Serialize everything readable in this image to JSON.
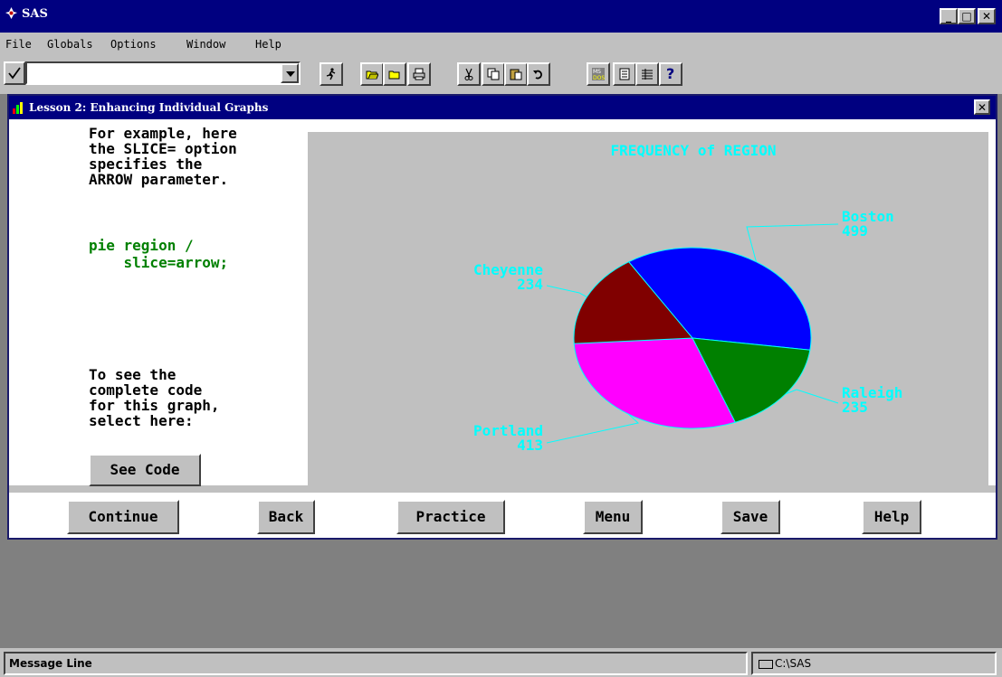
{
  "app": {
    "title": "SAS",
    "window_controls": {
      "minimize": "_",
      "maximize": "□",
      "close": "✕"
    }
  },
  "menu": [
    "File",
    "Globals",
    "Options",
    "Window",
    "Help"
  ],
  "toolbar": {
    "command_value": "",
    "icons": [
      "check-icon",
      "dropdown-arrow-icon",
      "run-icon",
      "open-icon",
      "save-icon",
      "print-icon",
      "cut-icon",
      "copy-icon",
      "paste-icon",
      "undo-icon",
      "msdos-icon",
      "properties-icon",
      "list-icon",
      "help-icon"
    ],
    "help_label": "?"
  },
  "lesson": {
    "title": "Lesson 2: Enhancing Individual Graphs",
    "close": "✕",
    "intro": "For example, here\nthe SLICE= option\nspecifies the\nARROW parameter.",
    "code": "pie region /\n    slice=arrow;",
    "see_code_prompt": "To see the\ncomplete code\nfor this graph,\nselect here:",
    "see_code_button": "See Code"
  },
  "chart_data": {
    "type": "pie",
    "title": "FREQUENCY of REGION",
    "slices": [
      {
        "label": "Boston",
        "value": 499,
        "color": "#0000ff"
      },
      {
        "label": "Raleigh",
        "value": 235,
        "color": "#008000"
      },
      {
        "label": "Portland",
        "value": 413,
        "color": "#ff00ff"
      },
      {
        "label": "Cheyenne",
        "value": 234,
        "color": "#800000"
      }
    ],
    "label_color": "#00ffff",
    "background": "#c0c0c0"
  },
  "nav": {
    "continue": "Continue",
    "back": "Back",
    "practice": "Practice",
    "menu": "Menu",
    "save": "Save",
    "help": "Help"
  },
  "status": {
    "message": "Message Line",
    "path": "C:\\SAS"
  }
}
